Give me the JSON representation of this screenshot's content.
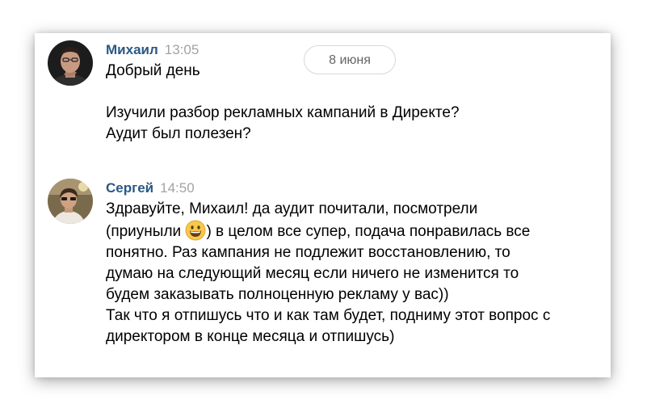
{
  "date_divider": "8 июня",
  "messages": [
    {
      "author": "Михаил",
      "time": "13:05",
      "avatar_icon": "avatar-mikhail",
      "text": "Добрый день\n\nИзучили разбор рекламных кампаний в Директе?\nАудит был полезен?"
    },
    {
      "author": "Сергей",
      "time": "14:50",
      "avatar_icon": "avatar-sergey",
      "text_before_emoji": "Здравуйте, Михаил! да аудит почитали, посмотрели\n(приуныли ",
      "emoji_icon": "grinning-face-emoji-icon",
      "text_after_emoji": ") в целом все супер, подача понравилась все\nпонятно. Раз кампания не подлежит восстановлению, то\nдумаю на следующий месяц если ничего не изменится то\nбудем заказывать полноценную рекламу у вас))\nТак что я отпишусь что и как там будет, подниму этот вопрос с\nдиректором в конце месяца и отпишусь)"
    }
  ],
  "colors": {
    "author": "#2a5885",
    "time": "#a3a3a3",
    "text": "#000000",
    "pill_border": "#d3d9de"
  }
}
